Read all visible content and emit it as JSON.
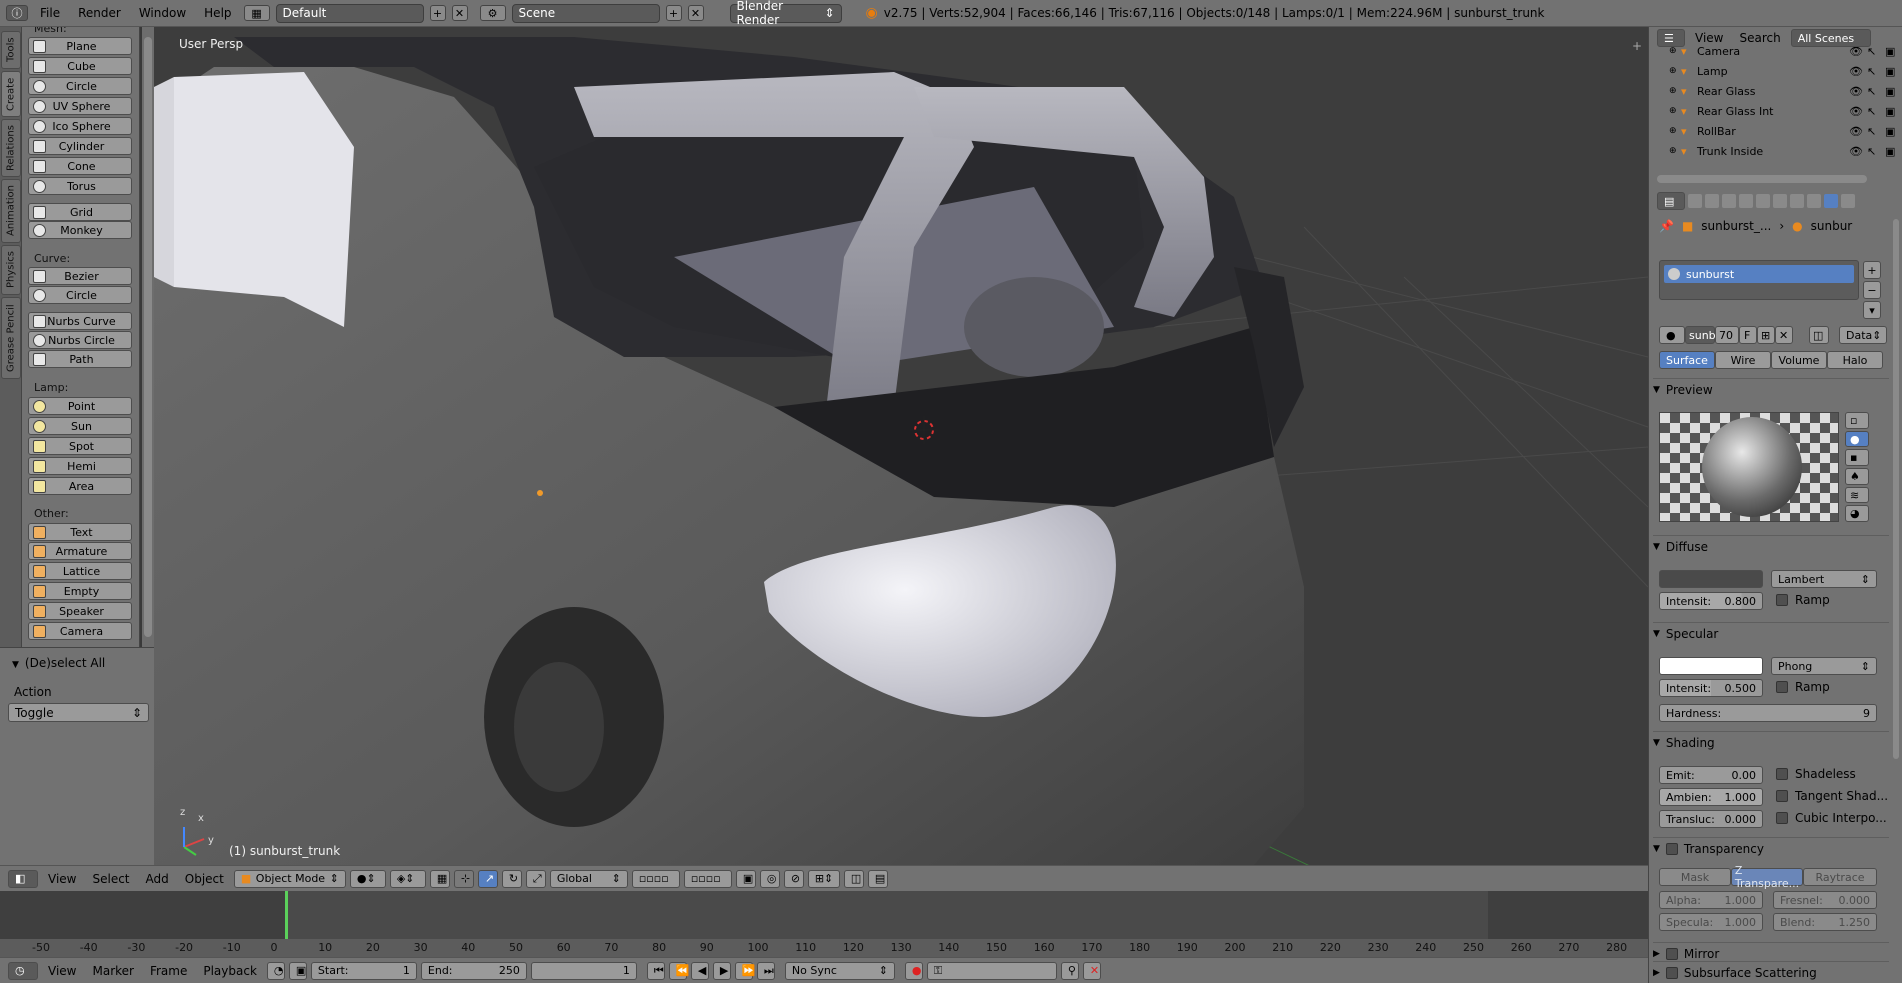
{
  "topbar": {
    "menus": [
      "File",
      "Render",
      "Window",
      "Help"
    ],
    "screen_layout": "Default",
    "scene": "Scene",
    "render_engine": "Blender Render",
    "stats": "v2.75 | Verts:52,904 | Faces:66,146 | Tris:67,116 | Objects:0/148 | Lamps:0/1 | Mem:224.96M | sunburst_trunk"
  },
  "tool_tabs": [
    "Tools",
    "Create",
    "Relations",
    "Animation",
    "Physics",
    "Grease Pencil"
  ],
  "toolshelf": {
    "mesh_header": "Mesh:",
    "mesh": [
      "Plane",
      "Cube",
      "Circle",
      "UV Sphere",
      "Ico Sphere",
      "Cylinder",
      "Cone",
      "Torus",
      "Grid",
      "Monkey"
    ],
    "curve_header": "Curve:",
    "curve": [
      "Bezier",
      "Circle",
      "Nurbs Curve",
      "Nurbs Circle",
      "Path"
    ],
    "lamp_header": "Lamp:",
    "lamp": [
      "Point",
      "Sun",
      "Spot",
      "Hemi",
      "Area"
    ],
    "other_header": "Other:",
    "other": [
      "Text",
      "Armature",
      "Lattice",
      "Empty",
      "Speaker",
      "Camera"
    ]
  },
  "operator_panel": {
    "title": "(De)select All",
    "action_label": "Action",
    "action_value": "Toggle"
  },
  "viewport": {
    "view_label": "User Persp",
    "object_label": "(1) sunburst_trunk",
    "axis_x": "x",
    "axis_y": "y",
    "axis_z": "z"
  },
  "viewport_header": {
    "menus": [
      "View",
      "Select",
      "Add",
      "Object"
    ],
    "mode": "Object Mode",
    "orientation": "Global"
  },
  "timeline": {
    "ticks": [
      "-50",
      "-40",
      "-30",
      "-20",
      "-10",
      "0",
      "10",
      "20",
      "30",
      "40",
      "50",
      "60",
      "70",
      "80",
      "90",
      "100",
      "110",
      "120",
      "130",
      "140",
      "150",
      "160",
      "170",
      "180",
      "190",
      "200",
      "210",
      "220",
      "230",
      "240",
      "250",
      "260",
      "270",
      "280"
    ],
    "current_frame": 1,
    "frame_start": 1,
    "frame_end": 250
  },
  "timeline_header": {
    "menus": [
      "View",
      "Marker",
      "Frame",
      "Playback"
    ],
    "start_label": "Start:",
    "start_value": "1",
    "end_label": "End:",
    "end_value": "250",
    "current_value": "1",
    "sync": "No Sync"
  },
  "outliner": {
    "menus": [
      "View",
      "Search"
    ],
    "filter": "All Scenes",
    "items": [
      "Camera",
      "Lamp",
      "Rear Glass",
      "Rear Glass Int",
      "RollBar",
      "Trunk Inside"
    ]
  },
  "properties": {
    "breadcrumb_object": "sunburst_...",
    "breadcrumb_material": "sunbur",
    "material_slot": "sunburst",
    "material_name": "sunb",
    "users": "70",
    "fake_user": "F",
    "link": "Data",
    "tabs": [
      "Surface",
      "Wire",
      "Volume",
      "Halo"
    ],
    "preview_header": "Preview",
    "diffuse_header": "Diffuse",
    "diffuse_shader": "Lambert",
    "diffuse_intensity_label": "Intensit:",
    "diffuse_intensity": "0.800",
    "ramp_label": "Ramp",
    "specular_header": "Specular",
    "specular_shader": "Phong",
    "specular_intensity_label": "Intensit:",
    "specular_intensity": "0.500",
    "hardness_label": "Hardness:",
    "hardness": "9",
    "shading_header": "Shading",
    "emit_label": "Emit:",
    "emit": "0.00",
    "ambient_label": "Ambien:",
    "ambient": "1.000",
    "translucency_label": "Transluc:",
    "translucency": "0.000",
    "shadeless_label": "Shadeless",
    "tangent_label": "Tangent Shad...",
    "cubic_label": "Cubic Interpo...",
    "transparency_header": "Transparency",
    "transparency_modes": [
      "Mask",
      "Z Transpare...",
      "Raytrace"
    ],
    "alpha_label": "Alpha:",
    "alpha": "1.000",
    "fresnel_label": "Fresnel:",
    "fresnel": "0.000",
    "specular_t_label": "Specula:",
    "specular_t": "1.000",
    "blend_label": "Blend:",
    "blend": "1.250",
    "mirror_header": "Mirror",
    "sss_header": "Subsurface Scattering"
  },
  "colors": {
    "accent_blue": "#5680c2",
    "panel_gray": "#727272",
    "viewport_bg": "#3d3d3d"
  }
}
